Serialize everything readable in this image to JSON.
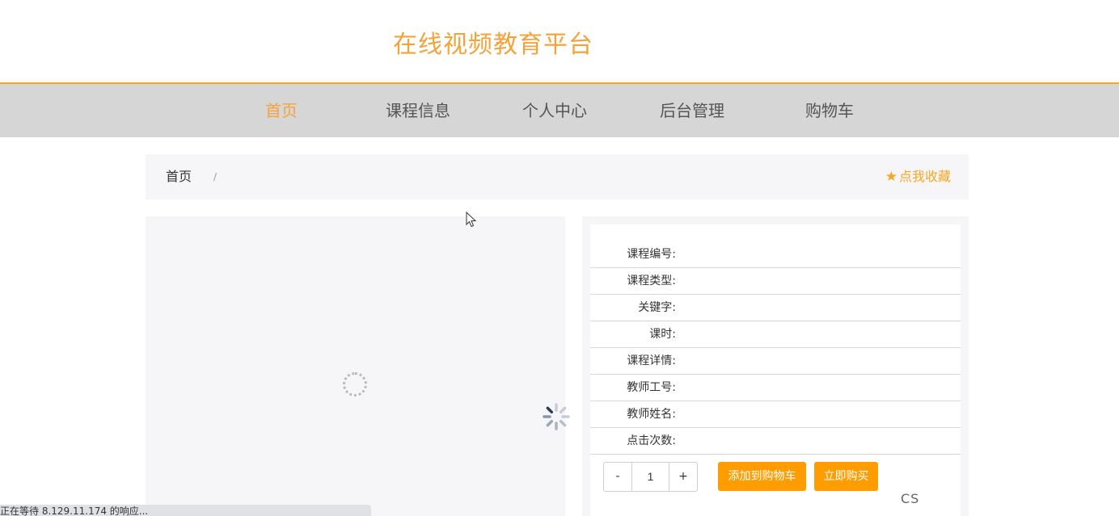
{
  "site": {
    "title": "在线视频教育平台"
  },
  "nav": {
    "items": [
      {
        "label": "首页",
        "active": true
      },
      {
        "label": "课程信息"
      },
      {
        "label": "个人中心"
      },
      {
        "label": "后台管理"
      },
      {
        "label": "购物车"
      }
    ]
  },
  "breadcrumb": {
    "home": "首页",
    "separator": "/"
  },
  "favorite": {
    "label": "点我收藏",
    "icon": "star-icon"
  },
  "details": {
    "rows": [
      {
        "label": "课程编号:",
        "value": ""
      },
      {
        "label": "课程类型:",
        "value": ""
      },
      {
        "label": "关键字:",
        "value": ""
      },
      {
        "label": "课时:",
        "value": ""
      },
      {
        "label": "课程详情:",
        "value": ""
      },
      {
        "label": "教师工号:",
        "value": ""
      },
      {
        "label": "教师姓名:",
        "value": ""
      },
      {
        "label": "点击次数:",
        "value": ""
      }
    ]
  },
  "purchase": {
    "minus_label": "-",
    "quantity": "1",
    "plus_label": "+",
    "add_to_cart_label": "添加到购物车",
    "buy_now_label": "立即购买"
  },
  "status_bar": {
    "text": "正在等待 8.129.11.174 的响应..."
  },
  "watermark": {
    "text": "CS"
  },
  "colors": {
    "accent": "#f5a23a",
    "button": "#ff9d00",
    "nav_background": "#d6d6d6"
  }
}
